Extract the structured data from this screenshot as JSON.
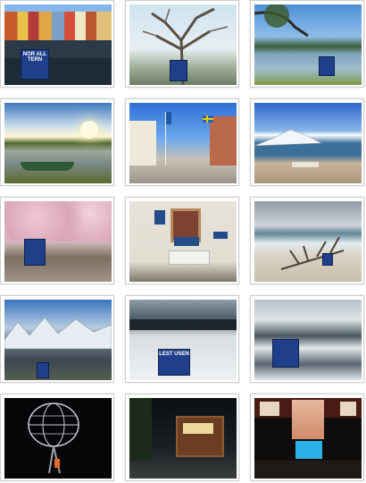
{
  "gallery": {
    "photos": [
      {
        "label": "Colorful harbor houses with boats",
        "bag_text": "NOR ALL TERN"
      },
      {
        "label": "Dry tree with shopping bag",
        "bag_text": ""
      },
      {
        "label": "Tree by a lake with bag",
        "bag_text": ""
      },
      {
        "label": "Sunset over water with green boat",
        "bag_text": ""
      },
      {
        "label": "Street with Swedish flags",
        "bag_text": ""
      },
      {
        "label": "Snowy mountain by the sea with bench",
        "bag_text": ""
      },
      {
        "label": "Cherry blossom trees street",
        "bag_text": ""
      },
      {
        "label": "White wooden house with bench and signs",
        "bag_text": ""
      },
      {
        "label": "Beach with driftwood branch",
        "bag_text": ""
      },
      {
        "label": "Snowy mountain lake with bag",
        "bag_text": ""
      },
      {
        "label": "Snow covered ground with bag",
        "bag_text": "LEST USEN"
      },
      {
        "label": "Ice floes with bag",
        "bag_text": ""
      },
      {
        "label": "Globe monument at night",
        "bag_text": ""
      },
      {
        "label": "Wooden hut at night",
        "bag_text": ""
      },
      {
        "label": "Shop window poster at night",
        "bag_text": ""
      }
    ]
  }
}
